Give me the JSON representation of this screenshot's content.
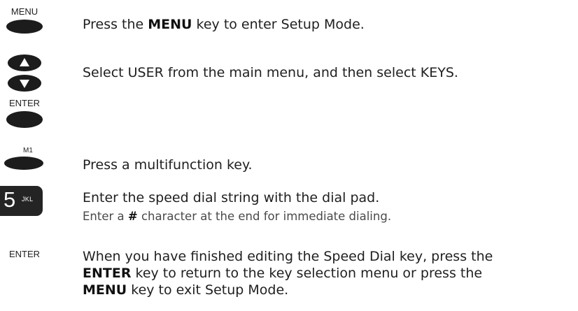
{
  "steps": {
    "menu": {
      "key_label": "MENU",
      "text_pre": "Press the ",
      "text_bold": "MENU",
      "text_post": " key to enter Setup Mode."
    },
    "select": {
      "enter_key_label": "ENTER",
      "text": "Select USER from the main menu, and then select KEYS."
    },
    "multifunction": {
      "key_label": "M1",
      "text": "Press a multifunction key."
    },
    "dial": {
      "key_digit": "5",
      "key_letters": "JKL",
      "text": "Enter the speed dial string with the dial pad.",
      "note_pre": "Enter a ",
      "note_bold": "#",
      "note_post": " character at the end for immediate dialing."
    },
    "finish": {
      "key_label": "ENTER",
      "line1": "When you have finished editing the Speed Dial key, press the",
      "line2_bold": "ENTER",
      "line2_post": " key to return to the key selection menu or press the",
      "line3_bold": "MENU",
      "line3_post": " key to exit Setup Mode."
    }
  },
  "icons": {
    "oval_key": "oval-key-icon",
    "up_arrow": "up-arrow-icon",
    "down_arrow": "down-arrow-icon",
    "dialpad_key": "dialpad-5-key-icon"
  },
  "colors": {
    "key_fill": "#1c1c1c",
    "text": "#1f1f1f",
    "note_text": "#4a4a4a"
  }
}
